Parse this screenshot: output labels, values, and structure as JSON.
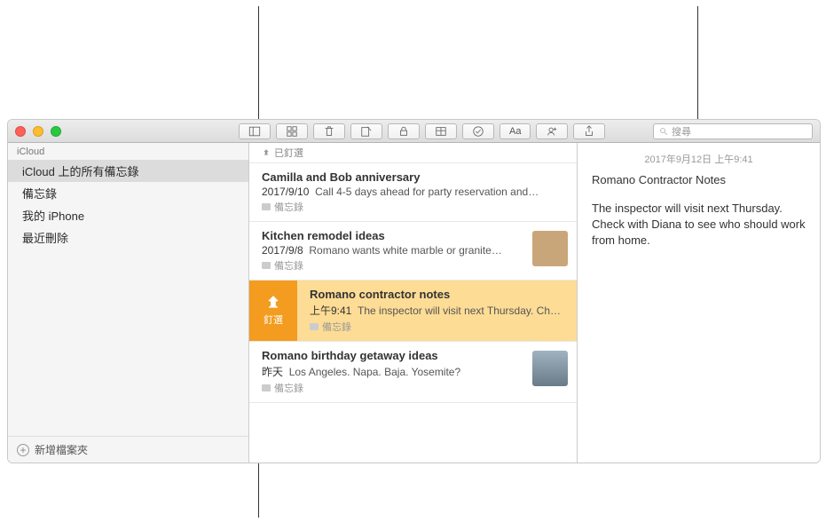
{
  "toolbar": {
    "search_placeholder": "搜尋"
  },
  "sidebar": {
    "section": "iCloud",
    "items": [
      {
        "label": "iCloud 上的所有備忘錄"
      },
      {
        "label": "備忘錄"
      },
      {
        "label": "我的 iPhone"
      },
      {
        "label": "最近刪除"
      }
    ],
    "new_folder": "新增檔案夾"
  },
  "pinned_label": "已釘選",
  "notes": [
    {
      "title": "Camilla and Bob anniversary",
      "date": "2017/9/10",
      "preview": "Call 4-5 days ahead for party reservation and…",
      "folder": "備忘錄"
    },
    {
      "title": "Kitchen remodel ideas",
      "date": "2017/9/8",
      "preview": "Romano wants white marble or granite…",
      "folder": "備忘錄",
      "thumb": "wood"
    },
    {
      "title": "Romano contractor notes",
      "date": "上午9:41",
      "preview": "The inspector will visit next Thursday. Check",
      "folder": "備忘錄",
      "pin_label": "釘選"
    },
    {
      "title": "Romano birthday getaway ideas",
      "date": "昨天",
      "preview": "Los Angeles. Napa. Baja. Yosemite?",
      "folder": "備忘錄",
      "thumb": "coast"
    }
  ],
  "editor": {
    "date": "2017年9月12日 上午9:41",
    "title": "Romano Contractor Notes",
    "body": "The inspector will visit next Thursday. Check with Diana to see who should work from home."
  }
}
